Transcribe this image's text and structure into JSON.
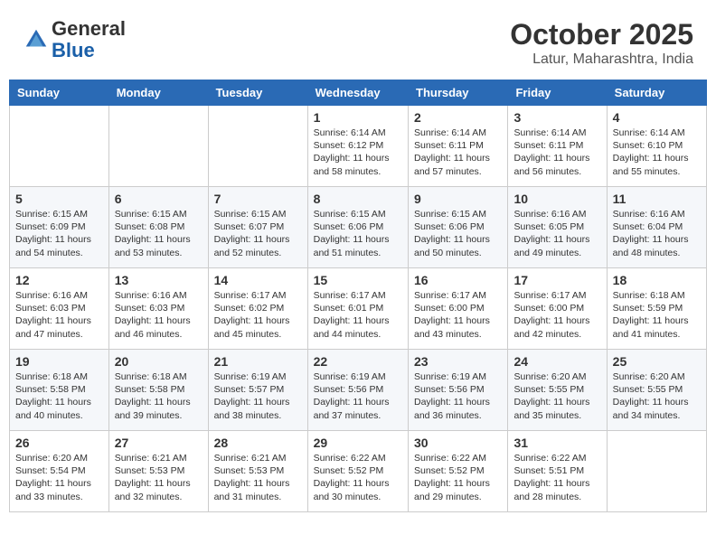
{
  "header": {
    "logo_line1": "General",
    "logo_line2": "Blue",
    "month": "October 2025",
    "location": "Latur, Maharashtra, India"
  },
  "weekdays": [
    "Sunday",
    "Monday",
    "Tuesday",
    "Wednesday",
    "Thursday",
    "Friday",
    "Saturday"
  ],
  "weeks": [
    [
      {
        "day": "",
        "info": ""
      },
      {
        "day": "",
        "info": ""
      },
      {
        "day": "",
        "info": ""
      },
      {
        "day": "1",
        "info": "Sunrise: 6:14 AM\nSunset: 6:12 PM\nDaylight: 11 hours and 58 minutes."
      },
      {
        "day": "2",
        "info": "Sunrise: 6:14 AM\nSunset: 6:11 PM\nDaylight: 11 hours and 57 minutes."
      },
      {
        "day": "3",
        "info": "Sunrise: 6:14 AM\nSunset: 6:11 PM\nDaylight: 11 hours and 56 minutes."
      },
      {
        "day": "4",
        "info": "Sunrise: 6:14 AM\nSunset: 6:10 PM\nDaylight: 11 hours and 55 minutes."
      }
    ],
    [
      {
        "day": "5",
        "info": "Sunrise: 6:15 AM\nSunset: 6:09 PM\nDaylight: 11 hours and 54 minutes."
      },
      {
        "day": "6",
        "info": "Sunrise: 6:15 AM\nSunset: 6:08 PM\nDaylight: 11 hours and 53 minutes."
      },
      {
        "day": "7",
        "info": "Sunrise: 6:15 AM\nSunset: 6:07 PM\nDaylight: 11 hours and 52 minutes."
      },
      {
        "day": "8",
        "info": "Sunrise: 6:15 AM\nSunset: 6:06 PM\nDaylight: 11 hours and 51 minutes."
      },
      {
        "day": "9",
        "info": "Sunrise: 6:15 AM\nSunset: 6:06 PM\nDaylight: 11 hours and 50 minutes."
      },
      {
        "day": "10",
        "info": "Sunrise: 6:16 AM\nSunset: 6:05 PM\nDaylight: 11 hours and 49 minutes."
      },
      {
        "day": "11",
        "info": "Sunrise: 6:16 AM\nSunset: 6:04 PM\nDaylight: 11 hours and 48 minutes."
      }
    ],
    [
      {
        "day": "12",
        "info": "Sunrise: 6:16 AM\nSunset: 6:03 PM\nDaylight: 11 hours and 47 minutes."
      },
      {
        "day": "13",
        "info": "Sunrise: 6:16 AM\nSunset: 6:03 PM\nDaylight: 11 hours and 46 minutes."
      },
      {
        "day": "14",
        "info": "Sunrise: 6:17 AM\nSunset: 6:02 PM\nDaylight: 11 hours and 45 minutes."
      },
      {
        "day": "15",
        "info": "Sunrise: 6:17 AM\nSunset: 6:01 PM\nDaylight: 11 hours and 44 minutes."
      },
      {
        "day": "16",
        "info": "Sunrise: 6:17 AM\nSunset: 6:00 PM\nDaylight: 11 hours and 43 minutes."
      },
      {
        "day": "17",
        "info": "Sunrise: 6:17 AM\nSunset: 6:00 PM\nDaylight: 11 hours and 42 minutes."
      },
      {
        "day": "18",
        "info": "Sunrise: 6:18 AM\nSunset: 5:59 PM\nDaylight: 11 hours and 41 minutes."
      }
    ],
    [
      {
        "day": "19",
        "info": "Sunrise: 6:18 AM\nSunset: 5:58 PM\nDaylight: 11 hours and 40 minutes."
      },
      {
        "day": "20",
        "info": "Sunrise: 6:18 AM\nSunset: 5:58 PM\nDaylight: 11 hours and 39 minutes."
      },
      {
        "day": "21",
        "info": "Sunrise: 6:19 AM\nSunset: 5:57 PM\nDaylight: 11 hours and 38 minutes."
      },
      {
        "day": "22",
        "info": "Sunrise: 6:19 AM\nSunset: 5:56 PM\nDaylight: 11 hours and 37 minutes."
      },
      {
        "day": "23",
        "info": "Sunrise: 6:19 AM\nSunset: 5:56 PM\nDaylight: 11 hours and 36 minutes."
      },
      {
        "day": "24",
        "info": "Sunrise: 6:20 AM\nSunset: 5:55 PM\nDaylight: 11 hours and 35 minutes."
      },
      {
        "day": "25",
        "info": "Sunrise: 6:20 AM\nSunset: 5:55 PM\nDaylight: 11 hours and 34 minutes."
      }
    ],
    [
      {
        "day": "26",
        "info": "Sunrise: 6:20 AM\nSunset: 5:54 PM\nDaylight: 11 hours and 33 minutes."
      },
      {
        "day": "27",
        "info": "Sunrise: 6:21 AM\nSunset: 5:53 PM\nDaylight: 11 hours and 32 minutes."
      },
      {
        "day": "28",
        "info": "Sunrise: 6:21 AM\nSunset: 5:53 PM\nDaylight: 11 hours and 31 minutes."
      },
      {
        "day": "29",
        "info": "Sunrise: 6:22 AM\nSunset: 5:52 PM\nDaylight: 11 hours and 30 minutes."
      },
      {
        "day": "30",
        "info": "Sunrise: 6:22 AM\nSunset: 5:52 PM\nDaylight: 11 hours and 29 minutes."
      },
      {
        "day": "31",
        "info": "Sunrise: 6:22 AM\nSunset: 5:51 PM\nDaylight: 11 hours and 28 minutes."
      },
      {
        "day": "",
        "info": ""
      }
    ]
  ]
}
